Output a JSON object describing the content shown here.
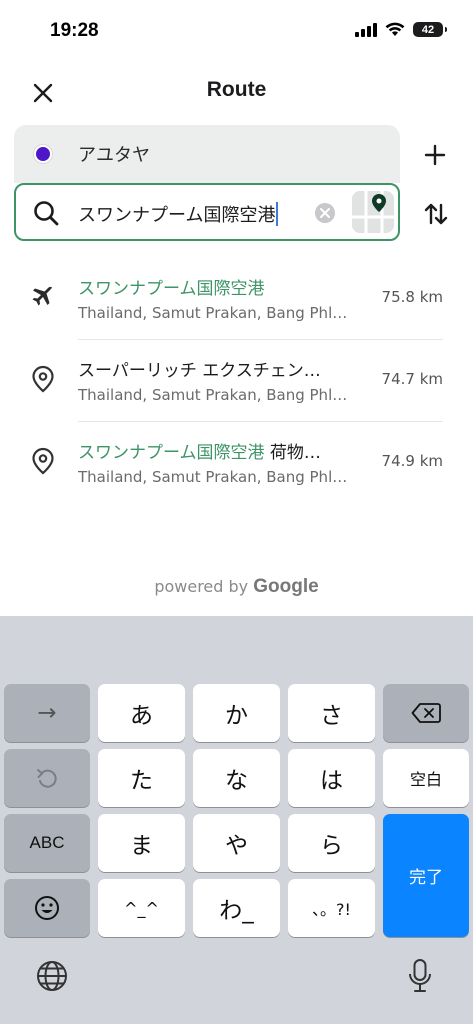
{
  "status_bar": {
    "time": "19:28",
    "battery": "42"
  },
  "header": {
    "title": "Route"
  },
  "route": {
    "origin": "アユタヤ",
    "destination": "スワンナプーム国際空港"
  },
  "results": [
    {
      "icon": "airplane-icon",
      "highlight": "スワンナプーム国際空港",
      "rest": "",
      "subtitle": "Thailand, Samut Prakan, Bang Phl…",
      "distance": "75.8 km"
    },
    {
      "icon": "location-pin-icon",
      "highlight": "",
      "rest": "スーパーリッチ エクスチェン…",
      "subtitle": "Thailand, Samut Prakan, Bang Phl…",
      "distance": "74.7 km"
    },
    {
      "icon": "location-pin-icon",
      "highlight": "スワンナプーム国際空港",
      "rest": " 荷物…",
      "subtitle": "Thailand, Samut Prakan, Bang Phl…",
      "distance": "74.9 km"
    }
  ],
  "attribution": {
    "prefix": "powered by ",
    "brand": "Google"
  },
  "keyboard": {
    "row1": [
      "→",
      "あ",
      "か",
      "さ",
      "⌫"
    ],
    "row2": [
      "↺",
      "た",
      "な",
      "は",
      "空白"
    ],
    "row3": [
      "ABC",
      "ま",
      "や",
      "ら"
    ],
    "row4": [
      "☺",
      "^_^",
      "わ_",
      "、。?!"
    ],
    "done": "完了"
  },
  "colors": {
    "accent_green": "#3e9467",
    "origin_purple": "#4d17c9",
    "keyboard_blue": "#0a84ff"
  }
}
